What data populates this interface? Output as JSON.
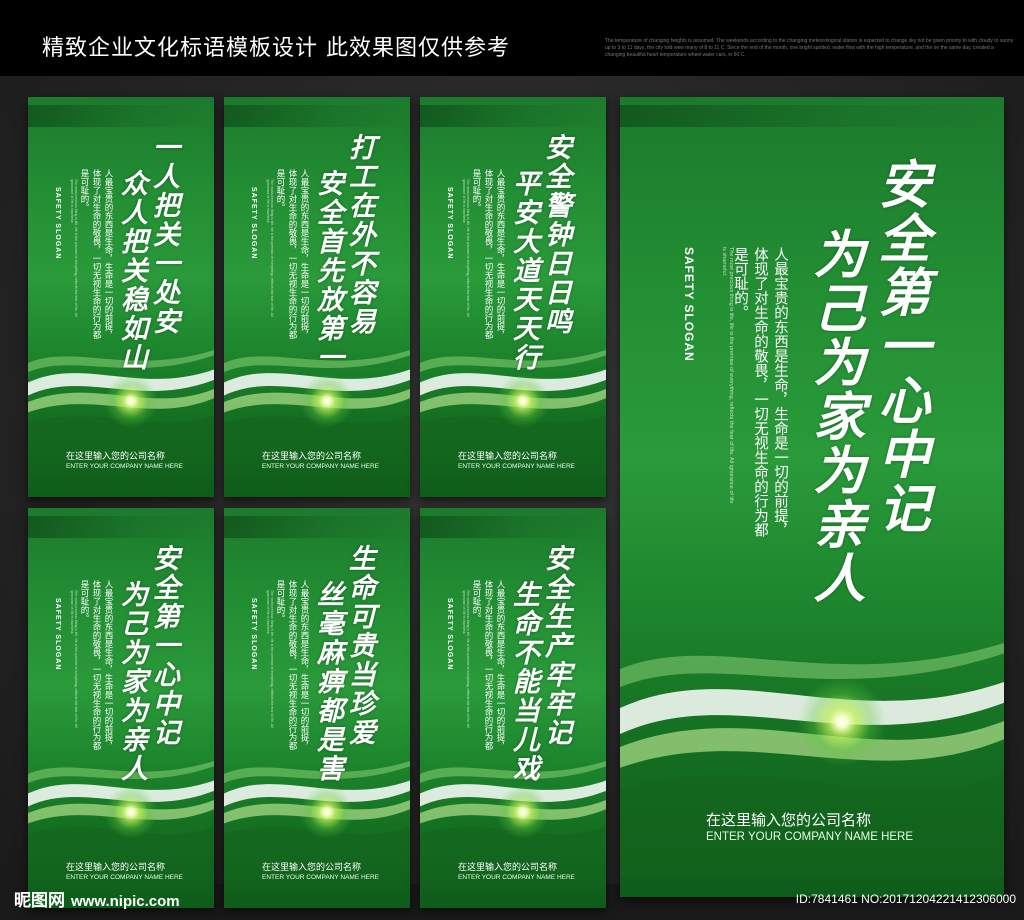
{
  "header": {
    "title": "精致企业文化标语模板设计  此效果图仅供参考",
    "fine_text": "The temperature of changing heights is assumed. The weekends according to the changing meteorological station is expected to change sky not be given priority to with cloudy to sunny up to 3 to 11 days, the city told view many of 8 to 11 C. Since the end of the month, one bright spotted, water flow with the high temperature, and the on the same day, created a changing beautiful heart temperature wheel water cars, in 60 C."
  },
  "common": {
    "en_slogan": "SAFETY SLOGAN",
    "body_text": "人最宝贵的东西是生命，生命是一切的前提，体现了对生命的敬畏，一切无视生命的行为都是可耻的。",
    "fine_print": "The most precious thing is life, life is the premise of everything, reflects the fear of life. All ignorance of life is shameful.",
    "company_cn": "在这里输入您的公司名称",
    "company_en": "ENTER YOUR COMPANY NAME HERE"
  },
  "posters": [
    {
      "slogan_col1": "一人把关一处安",
      "slogan_col2": "众人把关稳如山"
    },
    {
      "slogan_col1": "打工在外不容易",
      "slogan_col2": "安全首先放第一"
    },
    {
      "slogan_col1": "安全警钟日日鸣",
      "slogan_col2": "平安大道天天行"
    },
    {
      "slogan_col1": "安全第一心中记",
      "slogan_col2": "为己为家为亲人"
    },
    {
      "slogan_col1": "生命可贵当珍爱",
      "slogan_col2": "丝毫麻痹都是害"
    },
    {
      "slogan_col1": "安全生产牢牢记",
      "slogan_col2": "生命不能当儿戏"
    },
    {
      "slogan_col1": "安全第一心中记",
      "slogan_col2": "为己为家为亲人"
    }
  ],
  "footer": {
    "logo": "昵图网",
    "site": "www.nipic.com",
    "id_text": "ID:7841461 NO:20171204221412306000"
  },
  "colors": {
    "poster_green": "#238f34",
    "poster_dark_green": "#0e5c1a",
    "background": "#262626",
    "top_bar": "#000000"
  }
}
